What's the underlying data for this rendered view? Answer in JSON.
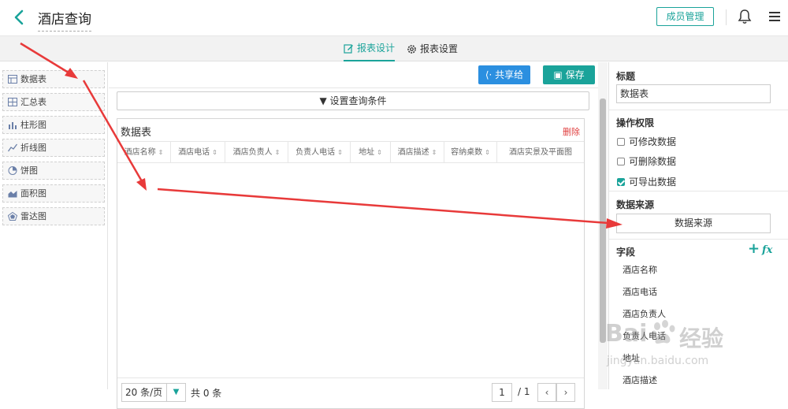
{
  "header": {
    "title": "酒店查询",
    "member_btn": "成员管理"
  },
  "tabs": [
    {
      "label": "报表设计",
      "active": true
    },
    {
      "label": "报表设置",
      "active": false
    }
  ],
  "components": [
    {
      "label": "数据表",
      "icon": "table-icon"
    },
    {
      "label": "汇总表",
      "icon": "summary-table-icon"
    },
    {
      "label": "柱形图",
      "icon": "bar-chart-icon"
    },
    {
      "label": "折线图",
      "icon": "line-chart-icon"
    },
    {
      "label": "饼图",
      "icon": "pie-chart-icon"
    },
    {
      "label": "面积图",
      "icon": "area-chart-icon"
    },
    {
      "label": "雷达图",
      "icon": "radar-chart-icon"
    }
  ],
  "toolbar": {
    "share_label": "共享给",
    "save_label": "保存",
    "query_label": "设置查询条件"
  },
  "table": {
    "title": "数据表",
    "delete_label": "删除",
    "columns": [
      "酒店名称",
      "酒店电话",
      "酒店负责人",
      "负责人电话",
      "地址",
      "酒店描述",
      "容纳桌数",
      "酒店实景及平面图"
    ]
  },
  "pager": {
    "page_size": "20 条/页",
    "total": "共 0 条",
    "page": "1",
    "of": "/ 1"
  },
  "props": {
    "title_label": "标题",
    "title_value": "数据表",
    "perm_label": "操作权限",
    "perms": [
      {
        "label": "可修改数据",
        "checked": false
      },
      {
        "label": "可删除数据",
        "checked": false
      },
      {
        "label": "可导出数据",
        "checked": true
      }
    ],
    "source_label": "数据来源",
    "source_btn": "数据来源",
    "fields_label": "字段",
    "fx": "fx",
    "fields": [
      "酒店名称",
      "酒店电话",
      "酒店负责人",
      "负责人电话",
      "地址",
      "酒店描述"
    ]
  },
  "watermark": {
    "brand_a": "Bai",
    "brand_b": "经验",
    "url": "jingyan.baidu.com"
  },
  "colors": {
    "accent": "#1aa39a",
    "share": "#2b8fe0",
    "annotation": "#e83a3a"
  }
}
